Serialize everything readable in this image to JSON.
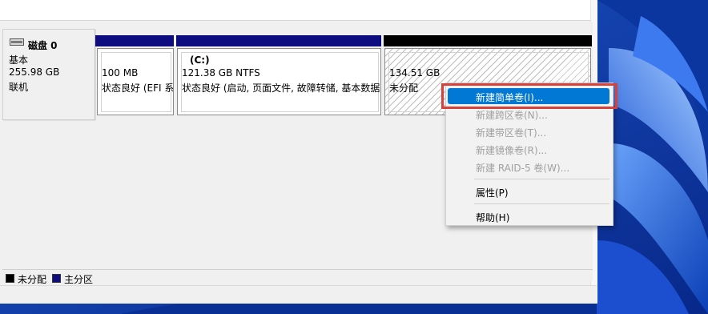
{
  "disk": {
    "name": "磁盘 0",
    "type": "基本",
    "size": "255.98 GB",
    "status": "联机"
  },
  "partitions": [
    {
      "size": "100 MB",
      "status": "状态良好 (EFI 系"
    },
    {
      "letter": "(C:)",
      "size": "121.38 GB NTFS",
      "status": "状态良好 (启动, 页面文件, 故障转储, 基本数据"
    },
    {
      "size": "134.51 GB",
      "status": "未分配"
    }
  ],
  "legend": [
    {
      "label": "未分配",
      "color": "#000000"
    },
    {
      "label": "主分区",
      "color": "#0d0d80"
    }
  ],
  "context_menu": {
    "items": [
      {
        "label": "新建简单卷(I)...",
        "enabled": true,
        "selected": true
      },
      {
        "label": "新建跨区卷(N)...",
        "enabled": false
      },
      {
        "label": "新建带区卷(T)...",
        "enabled": false
      },
      {
        "label": "新建镜像卷(R)...",
        "enabled": false
      },
      {
        "label": "新建 RAID-5 卷(W)...",
        "enabled": false
      },
      {
        "label": "属性(P)",
        "enabled": true
      },
      {
        "label": "帮助(H)",
        "enabled": true
      }
    ]
  },
  "colors": {
    "primary_partition": "#0d0d80",
    "unallocated": "#000000",
    "menu_selection": "#0078d4",
    "highlight_frame": "#d6413a"
  }
}
